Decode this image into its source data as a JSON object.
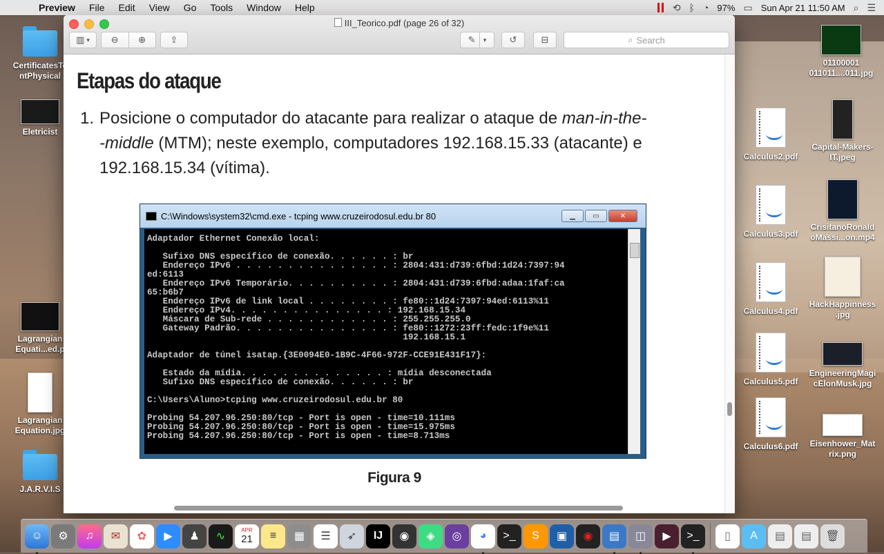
{
  "menubar": {
    "app_name": "Preview",
    "menus": [
      "File",
      "Edit",
      "View",
      "Go",
      "Tools",
      "Window",
      "Help"
    ],
    "battery": "97%",
    "clock": "Sun Apr 21  11:50 AM"
  },
  "desktop": {
    "left_icons": [
      {
        "label": "CertificatesTe\nntPhysical",
        "kind": "folder"
      },
      {
        "label": "Eletricist",
        "kind": "image"
      },
      {
        "label": "Lagrangian\nEquati...ed.p",
        "kind": "image"
      },
      {
        "label": "Lagrangian\nEquation.jpg",
        "kind": "image"
      },
      {
        "label": "J.A.R.V.I.S",
        "kind": "folder"
      }
    ],
    "right_icons": [
      {
        "label": "01100001\n011011....011.jpg"
      },
      {
        "label": "Calculus2.pdf"
      },
      {
        "label": "Capital-Makers-\nIT.jpeg"
      },
      {
        "label": "Calculus3.pdf"
      },
      {
        "label": "CrisitanoRonald\noMassi...on.mp4"
      },
      {
        "label": "Calculus4.pdf"
      },
      {
        "label": "HackHappinness\n.jpg"
      },
      {
        "label": "Calculus5.pdf"
      },
      {
        "label": "EngineeringMagi\ncElonMusk.jpg"
      },
      {
        "label": "Calculus6.pdf"
      },
      {
        "label": "Eisenhower_Mat\nrix.png"
      }
    ]
  },
  "window": {
    "title": "III_Teorico.pdf (page 26 of 32)",
    "search_placeholder": "Search"
  },
  "document": {
    "heading": "Etapas do ataque",
    "item_number": "1.",
    "line1_a": "Posicione o computador do atacante para realizar o ataque de ",
    "line1_em": "man-in-the-",
    "line2_em": "-middle",
    "line2_b": " (MTM); neste exemplo, computadores 192.168.15.33 (atacante) e",
    "line3": "192.168.15.34 (vítima).",
    "caption": "Figura 9"
  },
  "cmd": {
    "title": "C:\\Windows\\system32\\cmd.exe - tcping  www.cruzeirodosul.edu.br 80",
    "output": "Adaptador Ethernet Conexão local:\n\n   Sufixo DNS específico de conexão. . . . . . : br\n   Endereço IPv6 . . . . . . . . . . . . . . . : 2804:431:d739:6fbd:1d24:7397:94\ned:6113\n   Endereço IPv6 Temporário. . . . . . . . . . : 2804:431:d739:6fbd:adaa:1faf:ca\n65:b6b7\n   Endereço IPv6 de link local . . . . . . . . : fe80::1d24:7397:94ed:6113%11\n   Endereço IPv4. . . . . . . . . . . . . . . : 192.168.15.34\n   Máscara de Sub-rede . . . . . . . . . . . . : 255.255.255.0\n   Gateway Padrão. . . . . . . . . . . . . . . : fe80::1272:23ff:fedc:1f9e%11\n                                                 192.168.15.1\n\nAdaptador de túnel isatap.{3E0094E0-1B9C-4F66-972F-CCE91E431F17}:\n\n   Estado da mídia. . . . . . . . . . . . . . : mídia desconectada\n   Sufixo DNS específico de conexão. . . . . . : br\n\nC:\\Users\\Aluno>tcping www.cruzeirodosul.edu.br 80\n\nProbing 54.207.96.250:80/tcp - Port is open - time=10.111ms\nProbing 54.207.96.250:80/tcp - Port is open - time=15.975ms\nProbing 54.207.96.250:80/tcp - Port is open - time=8.713ms"
  },
  "dock": {
    "calendar_month": "APR",
    "calendar_day": "21"
  }
}
